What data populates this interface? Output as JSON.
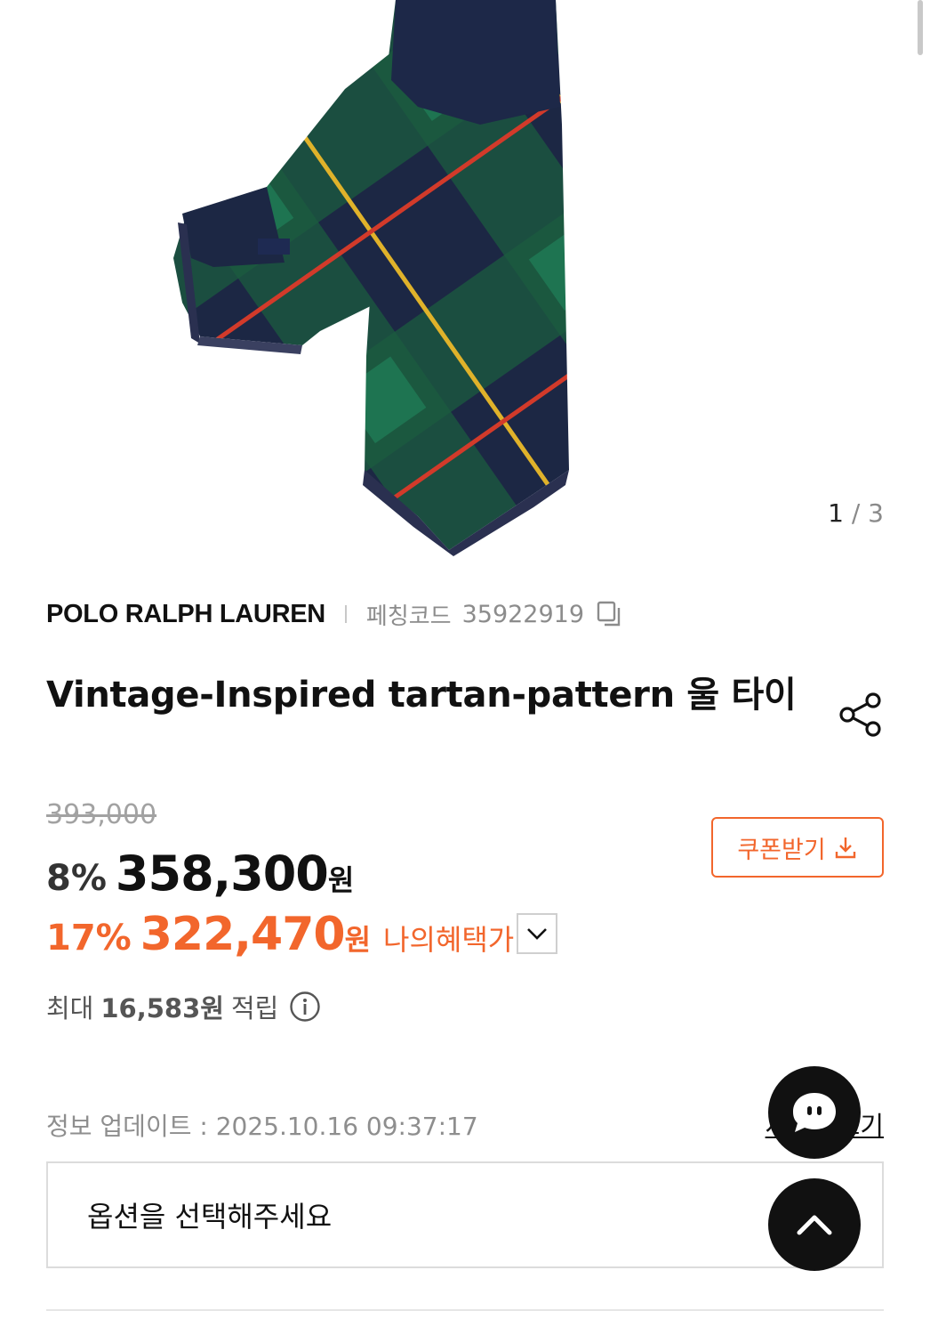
{
  "gallery": {
    "current": "1",
    "separator": "/",
    "total": "3",
    "image_alt": "tartan wool tie"
  },
  "product": {
    "brand": "POLO RALPH LAUREN",
    "code_label": "페칭코드",
    "code_value": "35922919",
    "title": "Vintage-Inspired tartan-pattern 울 타이"
  },
  "pricing": {
    "original_price": "393,000",
    "discount_rate": "8%",
    "sale_price": "358,300",
    "currency": "원",
    "benefit_discount_rate": "17%",
    "benefit_price": "322,470",
    "benefit_currency": "원",
    "benefit_label": "나의혜택가",
    "coupon_label": "쿠폰받기"
  },
  "points": {
    "prefix": "최대",
    "value": "16,583원",
    "suffix": "적립"
  },
  "info": {
    "update_text": "정보 업데이트 : 2025.10.16 09:37:17",
    "size_guide_label": "사이즈보기"
  },
  "options": {
    "placeholder": "옵션을 선택해주세요"
  },
  "colors": {
    "accent": "#f2662c",
    "text": "#111111",
    "muted": "#8c8c8c"
  },
  "icons": {
    "copy": "copy-icon",
    "share": "share-icon",
    "download": "download-icon",
    "chevron": "chevron-down-icon",
    "info": "info-icon",
    "chat": "chat-icon",
    "top": "arrow-up-icon"
  }
}
